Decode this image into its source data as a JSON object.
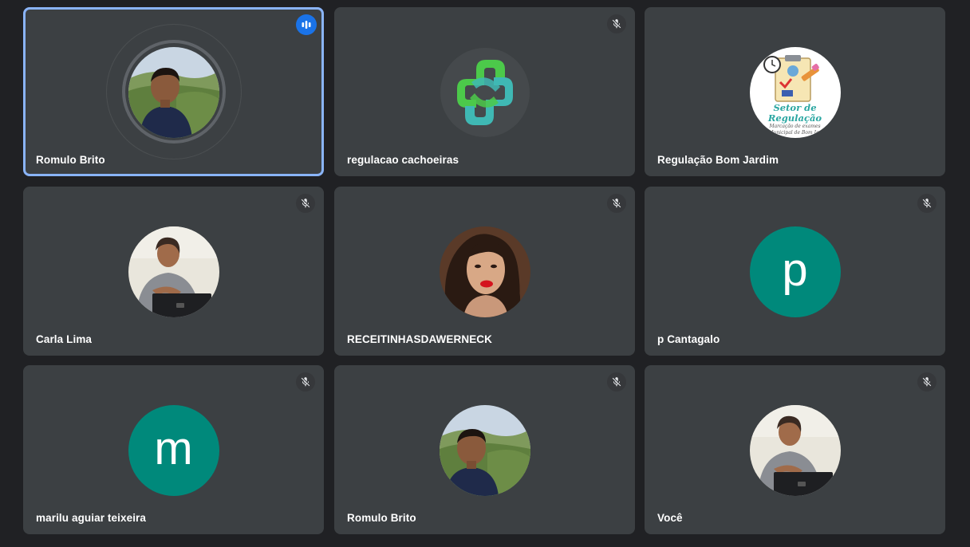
{
  "participants": [
    {
      "name": "Romulo Brito",
      "avatar": "photo-man-landscape",
      "status_icon": "speaking-indicator-icon",
      "speaking": true
    },
    {
      "name": "regulacao cachoeiras",
      "avatar": "logo-green-teal-cross",
      "status_icon": "mic-off-icon"
    },
    {
      "name": "Regulação Bom Jardim",
      "avatar": "logo-setor-de-regulacao",
      "status_icon": "none",
      "logo_text": {
        "title": "Setor de Regulação",
        "line2": "Marcação de exames",
        "line3": "a Municipal de Bom Jardi"
      }
    },
    {
      "name": "Carla Lima",
      "avatar": "photo-woman-laptop",
      "status_icon": "mic-off-icon"
    },
    {
      "name": "RECEITINHASDAWERNECK",
      "avatar": "photo-woman-red-lips",
      "status_icon": "mic-off-icon"
    },
    {
      "name": "p Cantagalo",
      "avatar": "letter",
      "avatar_letter": "p",
      "status_icon": "mic-off-icon"
    },
    {
      "name": "marilu aguiar teixeira",
      "avatar": "letter",
      "avatar_letter": "m",
      "status_icon": "mic-off-icon"
    },
    {
      "name": "Romulo Brito",
      "avatar": "photo-man-landscape",
      "status_icon": "mic-off-icon"
    },
    {
      "name": "Você",
      "avatar": "photo-woman-laptop",
      "status_icon": "mic-off-icon"
    }
  ],
  "colors": {
    "background": "#202124",
    "tile": "#3c4043",
    "active_border": "#8ab4f8",
    "speaking_badge": "#1a73e8",
    "letter_avatar": "#00897b"
  }
}
